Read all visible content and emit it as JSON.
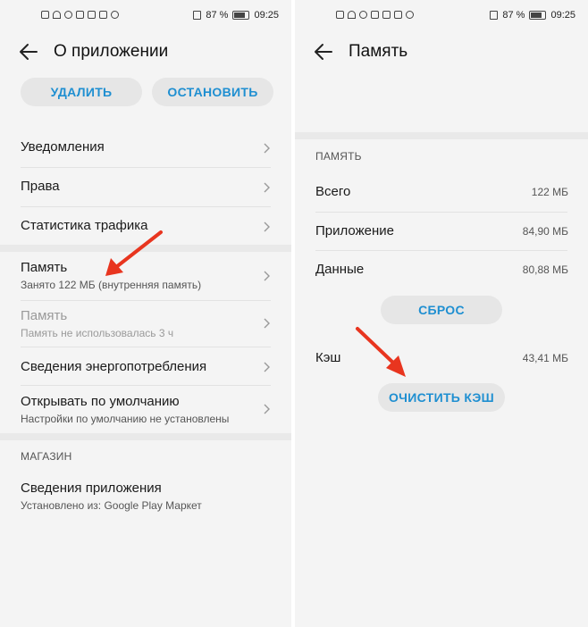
{
  "status": {
    "time": "09:25",
    "battery": "87 %"
  },
  "left": {
    "title": "О приложении",
    "buttons": {
      "uninstall": "УДАЛИТЬ",
      "stop": "ОСТАНОВИТЬ"
    },
    "items": [
      {
        "title": "Уведомления"
      },
      {
        "title": "Права"
      },
      {
        "title": "Статистика трафика"
      },
      {
        "title": "Память",
        "subtitle": "Занято 122 МБ (внутренняя память)"
      },
      {
        "title": "Память",
        "subtitle": "Память не использовалась 3 ч"
      },
      {
        "title": "Сведения энергопотребления"
      },
      {
        "title": "Открывать по умолчанию",
        "subtitle": "Настройки по умолчанию не установлены"
      }
    ],
    "store_section": "МАГАЗИН",
    "app_info": {
      "title": "Сведения приложения",
      "subtitle": "Установлено из: Google Play Маркет"
    }
  },
  "right": {
    "title": "Память",
    "section": "ПАМЯТЬ",
    "rows": [
      {
        "label": "Всего",
        "value": "122 МБ"
      },
      {
        "label": "Приложение",
        "value": "84,90 МБ"
      },
      {
        "label": "Данные",
        "value": "80,88 МБ"
      }
    ],
    "reset_button": "СБРОС",
    "cache": {
      "label": "Кэш",
      "value": "43,41 МБ"
    },
    "clear_cache_button": "ОЧИСТИТЬ КЭШ"
  },
  "colors": {
    "accent": "#1f8fd1",
    "annotation_arrow": "#e8351f",
    "background": "#f4f4f4"
  }
}
